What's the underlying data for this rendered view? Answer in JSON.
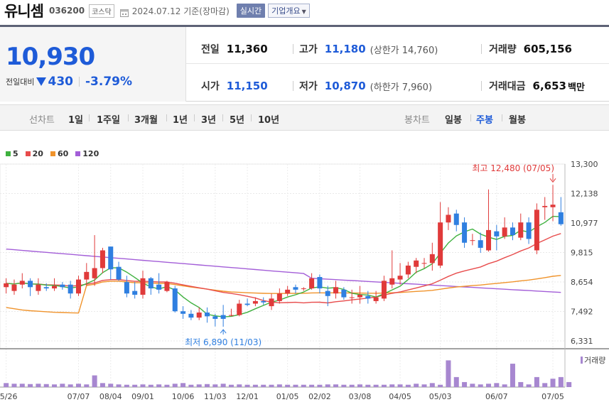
{
  "header": {
    "company_name": "유니셈",
    "code": "036200",
    "market": "코스닥",
    "date_label": "2024.07.12  기준(장마감)",
    "realtime_button": "실시간",
    "company_info_button": "기업개요",
    "calendar_icon": "calendar-icon"
  },
  "quote": {
    "price": "10,930",
    "change_label": "전일대비",
    "change": "430",
    "change_direction": "down",
    "change_pct": "-3.79%",
    "prev_close_label": "전일",
    "prev_close": "11,360",
    "high_label": "고가",
    "high": "11,180",
    "upper_limit": "(상한가 14,760)",
    "volume_label": "거래량",
    "volume": "605,156",
    "open_label": "시가",
    "open": "11,150",
    "low_label": "저가",
    "low": "10,870",
    "lower_limit": "(하한가 7,960)",
    "amount_label": "거래대금",
    "amount": "6,653",
    "amount_unit": "백만"
  },
  "period_bar": {
    "line_chart_label": "선차트",
    "periods": [
      "1일",
      "1주일",
      "3개월",
      "1년",
      "3년",
      "5년",
      "10년"
    ],
    "candle_chart_label": "봉차트",
    "candle_types": [
      "일봉",
      "주봉",
      "월봉"
    ],
    "active_candle": "주봉"
  },
  "legend": [
    {
      "label": "5",
      "color": "#3fb13f"
    },
    {
      "label": "20",
      "color": "#e84c4c"
    },
    {
      "label": "60",
      "color": "#f0932b"
    },
    {
      "label": "120",
      "color": "#a35ed8"
    }
  ],
  "colors": {
    "up": "#e03a3a",
    "down": "#2f7fe0",
    "accent": "#1e5bd8",
    "volume": "#a787d0"
  },
  "chart_data": {
    "type": "candlestick",
    "interval": "weekly",
    "y_ticks": [
      "13,300",
      "12,138",
      "10,977",
      "9,815",
      "8,654",
      "7,492",
      "6,331"
    ],
    "ylim": [
      6331,
      13300
    ],
    "x_ticks": [
      "05/26",
      "07/07",
      "08/04",
      "09/01",
      "10/06",
      "11/03",
      "12/01",
      "01/05",
      "02/02",
      "03/08",
      "04/05",
      "05/03",
      "06/07",
      "07/05"
    ],
    "max_annotation": "최고 12,480 (07/05)",
    "min_annotation": "최저 6,890 (11/03)",
    "volume_label": "거래량",
    "candles": [
      {
        "o": 8450,
        "c": 8600,
        "h": 8800,
        "l": 8200
      },
      {
        "o": 8300,
        "c": 8550,
        "h": 8750,
        "l": 8150
      },
      {
        "o": 8550,
        "c": 8700,
        "h": 9000,
        "l": 8400
      },
      {
        "o": 8700,
        "c": 8450,
        "h": 8800,
        "l": 8100
      },
      {
        "o": 8300,
        "c": 8550,
        "h": 8800,
        "l": 8150
      },
      {
        "o": 8450,
        "c": 8400,
        "h": 8600,
        "l": 8300
      },
      {
        "o": 8400,
        "c": 8500,
        "h": 8800,
        "l": 8300
      },
      {
        "o": 8550,
        "c": 8450,
        "h": 8650,
        "l": 8350
      },
      {
        "o": 8550,
        "c": 8200,
        "h": 8700,
        "l": 8000
      },
      {
        "o": 8200,
        "c": 8750,
        "h": 8900,
        "l": 8100
      },
      {
        "o": 8750,
        "c": 9050,
        "h": 9400,
        "l": 8500
      },
      {
        "o": 8800,
        "c": 9200,
        "h": 10500,
        "l": 8500
      },
      {
        "o": 9200,
        "c": 9900,
        "h": 10000,
        "l": 9000
      },
      {
        "o": 10050,
        "c": 9150,
        "h": 10050,
        "l": 8750
      },
      {
        "o": 9250,
        "c": 8750,
        "h": 9450,
        "l": 8700
      },
      {
        "o": 8650,
        "c": 8200,
        "h": 8900,
        "l": 8050
      },
      {
        "o": 8300,
        "c": 8150,
        "h": 8650,
        "l": 8000
      },
      {
        "o": 8150,
        "c": 8800,
        "h": 9100,
        "l": 8000
      },
      {
        "o": 8800,
        "c": 8400,
        "h": 8850,
        "l": 8150
      },
      {
        "o": 8550,
        "c": 8350,
        "h": 9000,
        "l": 8200
      },
      {
        "o": 8300,
        "c": 8650,
        "h": 8700,
        "l": 8250
      },
      {
        "o": 8400,
        "c": 7500,
        "h": 8500,
        "l": 7450
      },
      {
        "o": 7500,
        "c": 7400,
        "h": 7700,
        "l": 7200
      },
      {
        "o": 7400,
        "c": 7250,
        "h": 7550,
        "l": 7150
      },
      {
        "o": 7250,
        "c": 7450,
        "h": 7650,
        "l": 7150
      },
      {
        "o": 7450,
        "c": 7300,
        "h": 7650,
        "l": 7050
      },
      {
        "o": 7300,
        "c": 7200,
        "h": 7400,
        "l": 6900
      },
      {
        "o": 7350,
        "c": 7200,
        "h": 7750,
        "l": 6890
      },
      {
        "o": 7350,
        "c": 7350,
        "h": 7600,
        "l": 7300
      },
      {
        "o": 7350,
        "c": 7800,
        "h": 7950,
        "l": 7300
      },
      {
        "o": 7800,
        "c": 7750,
        "h": 8000,
        "l": 7700
      },
      {
        "o": 7800,
        "c": 7900,
        "h": 8050,
        "l": 7700
      },
      {
        "o": 7900,
        "c": 7850,
        "h": 8050,
        "l": 7750
      },
      {
        "o": 7700,
        "c": 8000,
        "h": 8200,
        "l": 7550
      },
      {
        "o": 7900,
        "c": 8200,
        "h": 8400,
        "l": 7800
      },
      {
        "o": 8200,
        "c": 8350,
        "h": 8500,
        "l": 8100
      },
      {
        "o": 8450,
        "c": 8350,
        "h": 8550,
        "l": 8200
      },
      {
        "o": 8400,
        "c": 8400,
        "h": 8450,
        "l": 8300
      },
      {
        "o": 8400,
        "c": 8800,
        "h": 9000,
        "l": 8350
      },
      {
        "o": 8850,
        "c": 8400,
        "h": 8950,
        "l": 8200
      },
      {
        "o": 8300,
        "c": 8100,
        "h": 8500,
        "l": 7700
      },
      {
        "o": 8200,
        "c": 8450,
        "h": 8700,
        "l": 8000
      },
      {
        "o": 8350,
        "c": 8050,
        "h": 8450,
        "l": 7950
      },
      {
        "o": 8050,
        "c": 8050,
        "h": 8350,
        "l": 7800
      },
      {
        "o": 8050,
        "c": 8150,
        "h": 8500,
        "l": 7800
      },
      {
        "o": 8100,
        "c": 8000,
        "h": 8300,
        "l": 7800
      },
      {
        "o": 7900,
        "c": 8050,
        "h": 8300,
        "l": 7800
      },
      {
        "o": 8000,
        "c": 8700,
        "h": 8900,
        "l": 7900
      },
      {
        "o": 8550,
        "c": 8800,
        "h": 9900,
        "l": 8400
      },
      {
        "o": 8750,
        "c": 8900,
        "h": 9400,
        "l": 8550
      },
      {
        "o": 8950,
        "c": 9300,
        "h": 9450,
        "l": 8800
      },
      {
        "o": 9250,
        "c": 9500,
        "h": 9600,
        "l": 9000
      },
      {
        "o": 9400,
        "c": 9400,
        "h": 9600,
        "l": 9200
      },
      {
        "o": 9400,
        "c": 9750,
        "h": 10200,
        "l": 9100
      },
      {
        "o": 9300,
        "c": 11000,
        "h": 11800,
        "l": 9200
      },
      {
        "o": 11000,
        "c": 11300,
        "h": 11600,
        "l": 10700
      },
      {
        "o": 11350,
        "c": 10900,
        "h": 11500,
        "l": 10650
      },
      {
        "o": 11000,
        "c": 10200,
        "h": 11200,
        "l": 10000
      },
      {
        "o": 10300,
        "c": 10300,
        "h": 10550,
        "l": 10100
      },
      {
        "o": 10300,
        "c": 10000,
        "h": 10600,
        "l": 9800
      },
      {
        "o": 9900,
        "c": 10700,
        "h": 12300,
        "l": 9850
      },
      {
        "o": 10650,
        "c": 10450,
        "h": 10900,
        "l": 9900
      },
      {
        "o": 10450,
        "c": 10800,
        "h": 11200,
        "l": 10350
      },
      {
        "o": 10800,
        "c": 10500,
        "h": 11000,
        "l": 10300
      },
      {
        "o": 10400,
        "c": 11000,
        "h": 11350,
        "l": 10300
      },
      {
        "o": 11000,
        "c": 10350,
        "h": 11200,
        "l": 10150
      },
      {
        "o": 9900,
        "c": 11500,
        "h": 11750,
        "l": 9750
      },
      {
        "o": 11600,
        "c": 11650,
        "h": 12000,
        "l": 11100
      },
      {
        "o": 11600,
        "c": 11700,
        "h": 12480,
        "l": 11050
      },
      {
        "o": 11400,
        "c": 10930,
        "h": 12000,
        "l": 10870
      }
    ],
    "volume": [
      0.12,
      0.1,
      0.1,
      0.09,
      0.1,
      0.09,
      0.08,
      0.1,
      0.08,
      0.1,
      0.08,
      0.35,
      0.12,
      0.1,
      0.08,
      0.07,
      0.07,
      0.08,
      0.07,
      0.08,
      0.07,
      0.1,
      0.12,
      0.07,
      0.08,
      0.09,
      0.08,
      0.1,
      0.07,
      0.08,
      0.07,
      0.07,
      0.07,
      0.07,
      0.08,
      0.07,
      0.07,
      0.07,
      0.07,
      0.07,
      0.08,
      0.08,
      0.07,
      0.07,
      0.08,
      0.07,
      0.07,
      0.07,
      0.08,
      0.08,
      0.07,
      0.1,
      0.08,
      0.12,
      0.07,
      0.8,
      0.3,
      0.15,
      0.1,
      0.08,
      0.1,
      0.12,
      0.08,
      0.7,
      0.15,
      0.08,
      0.3,
      0.12,
      0.25,
      0.3,
      0.15
    ]
  }
}
